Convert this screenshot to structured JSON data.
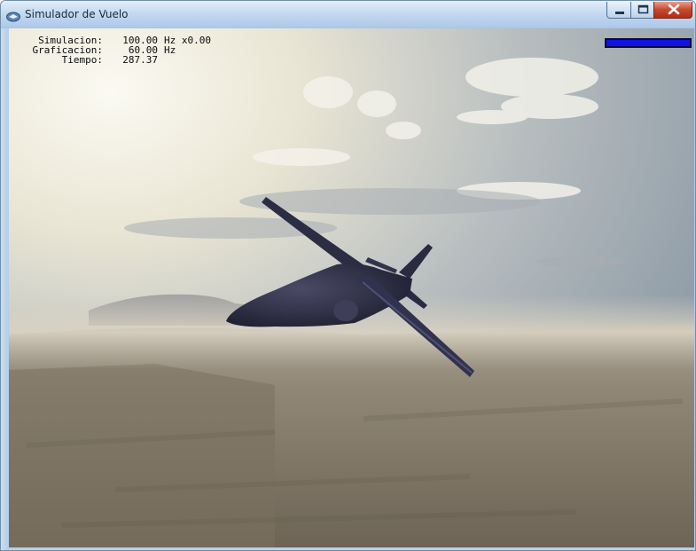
{
  "window": {
    "title": "Simulador de Vuelo",
    "controls": {
      "minimize": "minimize",
      "maximize": "maximize",
      "close": "close"
    }
  },
  "hud": {
    "rows": [
      {
        "label": "Simulacion:",
        "value": "100.00",
        "unit": "Hz x0.00"
      },
      {
        "label": "Graficacion:",
        "value": "60.00",
        "unit": "Hz"
      },
      {
        "label": "Tiempo:",
        "value": "287.37",
        "unit": ""
      }
    ]
  },
  "status_bar": {
    "fill": 1.0,
    "color": "#1212e6"
  },
  "icons": [
    "app-icon",
    "minimize-icon",
    "maximize-icon",
    "close-icon"
  ],
  "colors": {
    "titlebar": "#c5daf1",
    "close": "#c7472f",
    "aircraft": "#2c2c44"
  }
}
